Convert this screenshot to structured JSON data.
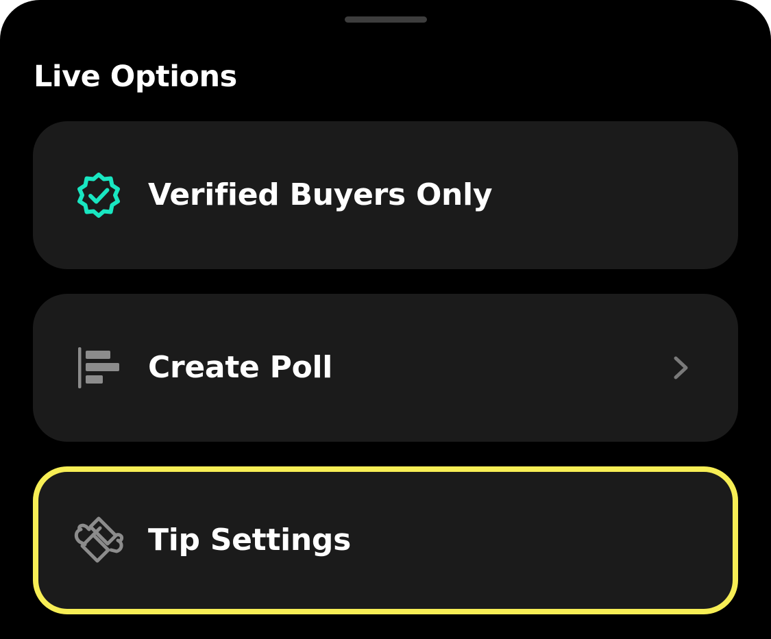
{
  "sheet": {
    "title": "Live Options"
  },
  "options": [
    {
      "label": "Verified Buyers Only",
      "icon": "verified-badge-icon",
      "icon_color": "#19e6c1"
    },
    {
      "label": "Create Poll",
      "icon": "poll-bars-icon",
      "icon_color": "#8c8c8c",
      "trailing_icon": "chevron-right-icon"
    },
    {
      "label": "Tip Settings",
      "icon": "winged-money-icon",
      "icon_color": "#8c8c8c",
      "highlighted": true
    }
  ],
  "colors": {
    "background": "#000000",
    "card": "#1b1b1b",
    "text": "#ffffff",
    "accent_verified": "#19e6c1",
    "highlight_border": "#f7ee55"
  }
}
